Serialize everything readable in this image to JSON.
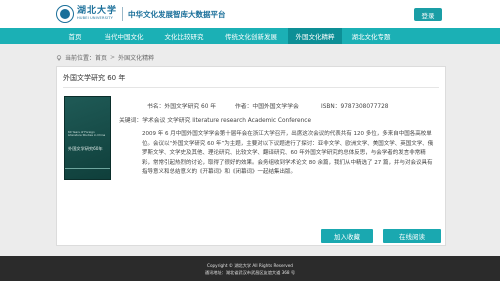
{
  "header": {
    "logo_cn": "湖北大学",
    "logo_en": "HUBEI UNIVERSITY",
    "site_title": "中华文化发展智库大数据平台",
    "login_label": "登录"
  },
  "nav": {
    "items": [
      {
        "label": "首页",
        "active": false
      },
      {
        "label": "当代中国文化",
        "active": false
      },
      {
        "label": "文化比较研究",
        "active": false
      },
      {
        "label": "传统文化创新发展",
        "active": false
      },
      {
        "label": "外国文化精粹",
        "active": true
      },
      {
        "label": "湖北文化专题",
        "active": false
      }
    ]
  },
  "breadcrumb": {
    "prefix": "当前位置：",
    "items": [
      "首页",
      "外国文化精粹"
    ],
    "separator": ">"
  },
  "book": {
    "title": "外国文学研究 60 年",
    "cover_en": "60 Years of Foreign Literature Studies in China",
    "cover_cn": "外国文学研究60年",
    "meta": {
      "title_label": "书名：",
      "title_value": "外国文学研究 60 年",
      "author_label": "作者：",
      "author_value": "中国外国文学学会",
      "isbn_label": "ISBN：",
      "isbn_value": "9787308077728"
    },
    "keywords_label": "关键词：",
    "keywords_value": "学术会议 文学研究 literature research Academic Conference",
    "description": "2009 年 6 月中国外国文学学会第十届年会在浙江大学召开，出席这次会议的代表共有 120 多位，多来自中国各高校单位。会议以“外国文学研究 60 年”为主题，主要对以下议题进行了探讨：亚非文学、欧洲文学、美国文学、英国文学、俄罗斯文学、文学史及其他、理论研究、比较文学、翻译研究、60 年外国文学研究的总体反思，与会学者的发言非常精彩，常常引起热烈的讨论，取得了很好的效果。会务组收到学术论文 80 余篇，我们从中精选了 27 篇，并与对会议具有指导意义和总结意义的《开幕词》和《闭幕词》一起结集出版。"
  },
  "actions": {
    "favorite_label": "加入收藏",
    "read_online_label": "在线阅读"
  },
  "footer": {
    "copyright": "Copyright © 湖北大学 All Rights Reserved",
    "address": "通讯地址：湖北省武汉市武昌区友谊大道 368 号"
  },
  "colors": {
    "brand_blue": "#1a6f9a",
    "nav_teal": "#1bb0b5",
    "nav_active": "#0d8f96",
    "button_teal": "#1aa8b0",
    "footer_bg": "#2b2b2b"
  }
}
